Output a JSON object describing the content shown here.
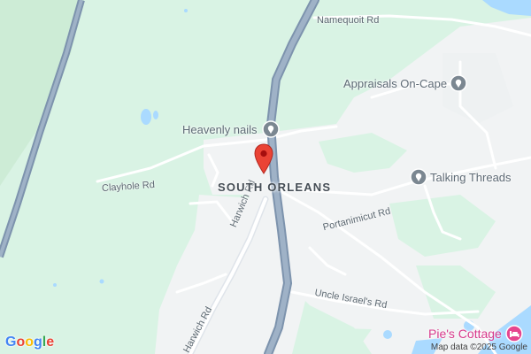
{
  "map": {
    "area_label": "SOUTH ORLEANS",
    "roads": {
      "namequoit": "Namequoit Rd",
      "clayhole": "Clayhole Rd",
      "harwich_1": "Harwich Rd",
      "harwich_2": "Harwich Rd",
      "portanimicut": "Portanimicut Rd",
      "uncle_israels": "Uncle Israel's Rd"
    },
    "pois": {
      "appraisals": "Appraisals On-Cape",
      "heavenly_nails": "Heavenly nails",
      "talking_threads": "Talking Threads",
      "pies_cottage": "Pie's Cottage"
    },
    "marker": "selected-location-pin",
    "colors": {
      "land": "#f1f3f4",
      "park": "#d9f3e4",
      "water": "#aadaff",
      "highway": "#8ea3bb",
      "road": "#ffffff",
      "marker": "#ea4335",
      "poi_icon": "#7b8791",
      "lodging": "#e6458f"
    }
  },
  "footer": {
    "logo": [
      "G",
      "o",
      "o",
      "g",
      "l",
      "e"
    ],
    "attribution": "Map data ©2025 Google"
  }
}
